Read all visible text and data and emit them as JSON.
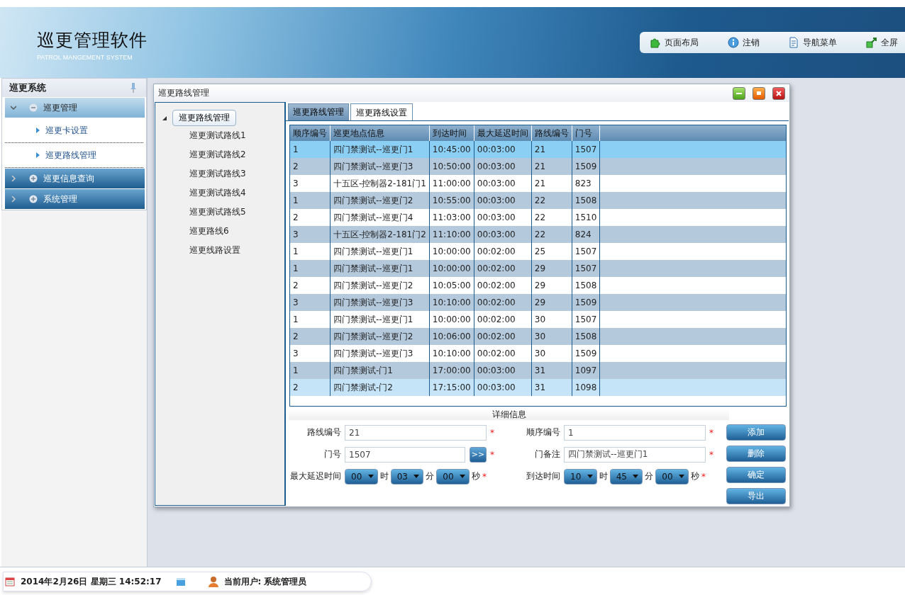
{
  "header": {
    "title": "巡更管理软件",
    "subtitle": "PATROL MANGEMENT SYSTEM",
    "toolbar": [
      {
        "label": "页面布局",
        "kind": "layout"
      },
      {
        "label": "注销",
        "kind": "info"
      },
      {
        "label": "导航菜单",
        "kind": "doc"
      },
      {
        "label": "全屏",
        "kind": "fullscreen"
      }
    ]
  },
  "sidebar": {
    "title": "巡更系统",
    "groups": [
      {
        "label": "巡更管理",
        "expanded": true,
        "children": [
          {
            "label": "巡更卡设置"
          },
          {
            "label": "巡更路线管理"
          }
        ]
      },
      {
        "label": "巡更信息查询",
        "expanded": false
      },
      {
        "label": "系统管理",
        "expanded": false
      }
    ]
  },
  "window": {
    "title": "巡更路线管理",
    "tree": {
      "label": "巡更路线管理",
      "expanded": true,
      "children": [
        {
          "label": "巡更测试路线1"
        },
        {
          "label": "巡更测试路线2"
        },
        {
          "label": "巡更测试路线3"
        },
        {
          "label": "巡更测试路线4"
        },
        {
          "label": "巡更测试路线5"
        },
        {
          "label": "巡更路线6"
        },
        {
          "label": "巡更线路设置"
        }
      ]
    },
    "tabs": [
      {
        "label": "巡更路线管理",
        "selected": false
      },
      {
        "label": "巡更路线设置",
        "selected": true
      }
    ],
    "table": {
      "columns": [
        "顺序编号",
        "巡更地点信息",
        "到达时间",
        "最大延迟时间",
        "路线编号",
        "门号"
      ],
      "rows": [
        {
          "cells": [
            "1",
            "四门禁测试--巡更门1",
            "10:45:00",
            "00:03:00",
            "21",
            "1507"
          ],
          "selected": true,
          "hovered": false
        },
        {
          "cells": [
            "2",
            "四门禁测试--巡更门3",
            "10:50:00",
            "00:03:00",
            "21",
            "1509"
          ],
          "selected": false,
          "hovered": false
        },
        {
          "cells": [
            "3",
            "十五区-控制器2-181门1",
            "11:00:00",
            "00:03:00",
            "21",
            "823"
          ],
          "selected": false,
          "hovered": false
        },
        {
          "cells": [
            "1",
            "四门禁测试--巡更门2",
            "10:55:00",
            "00:03:00",
            "22",
            "1508"
          ],
          "selected": false,
          "hovered": false
        },
        {
          "cells": [
            "2",
            "四门禁测试--巡更门4",
            "11:03:00",
            "00:03:00",
            "22",
            "1510"
          ],
          "selected": false,
          "hovered": false
        },
        {
          "cells": [
            "3",
            "十五区-控制器2-181门2",
            "11:10:00",
            "00:03:00",
            "22",
            "824"
          ],
          "selected": false,
          "hovered": false
        },
        {
          "cells": [
            "1",
            "四门禁测试--巡更门1",
            "10:00:00",
            "00:02:00",
            "25",
            "1507"
          ],
          "selected": false,
          "hovered": false
        },
        {
          "cells": [
            "1",
            "四门禁测试--巡更门1",
            "10:00:00",
            "00:02:00",
            "29",
            "1507"
          ],
          "selected": false,
          "hovered": false
        },
        {
          "cells": [
            "2",
            "四门禁测试--巡更门2",
            "10:05:00",
            "00:02:00",
            "29",
            "1508"
          ],
          "selected": false,
          "hovered": false
        },
        {
          "cells": [
            "3",
            "四门禁测试--巡更门3",
            "10:10:00",
            "00:02:00",
            "29",
            "1509"
          ],
          "selected": false,
          "hovered": false
        },
        {
          "cells": [
            "1",
            "四门禁测试--巡更门1",
            "10:00:00",
            "00:02:00",
            "30",
            "1507"
          ],
          "selected": false,
          "hovered": false
        },
        {
          "cells": [
            "2",
            "四门禁测试--巡更门2",
            "10:06:00",
            "00:02:00",
            "30",
            "1508"
          ],
          "selected": false,
          "hovered": false
        },
        {
          "cells": [
            "3",
            "四门禁测试--巡更门3",
            "10:10:00",
            "00:02:00",
            "30",
            "1509"
          ],
          "selected": false,
          "hovered": false
        },
        {
          "cells": [
            "1",
            "四门禁测试-门1",
            "17:00:00",
            "00:03:00",
            "31",
            "1097"
          ],
          "selected": false,
          "hovered": false
        },
        {
          "cells": [
            "2",
            "四门禁测试-门2",
            "17:15:00",
            "00:03:00",
            "31",
            "1098"
          ],
          "selected": false,
          "hovered": true
        }
      ]
    },
    "details": {
      "title": "详细信息",
      "route_no": {
        "label": "路线编号",
        "value": "21",
        "required": "*"
      },
      "seq_no": {
        "label": "顺序编号",
        "value": "1",
        "required": "*"
      },
      "door_no": {
        "label": "门号",
        "value": "1507",
        "pick": ">>",
        "required": "*"
      },
      "door_note": {
        "label": "门备注",
        "value": "四门禁测试--巡更门1",
        "required": "*"
      },
      "max_delay": {
        "label": "最大延迟时间",
        "hour": "00",
        "hour_unit": "时",
        "minute": "03",
        "minute_unit": "分",
        "second": "00",
        "second_unit": "秒",
        "required": "*"
      },
      "arrival": {
        "label": "到达时间",
        "hour": "10",
        "hour_unit": "时",
        "minute": "45",
        "minute_unit": "分",
        "second": "00",
        "second_unit": "秒",
        "required": "*"
      },
      "buttons": [
        "添加",
        "删除",
        "确定",
        "导出"
      ]
    }
  },
  "status_bar": {
    "datetime": "2014年2月26日 星期三 14:52:17",
    "user": "当前用户: 系统管理员"
  }
}
